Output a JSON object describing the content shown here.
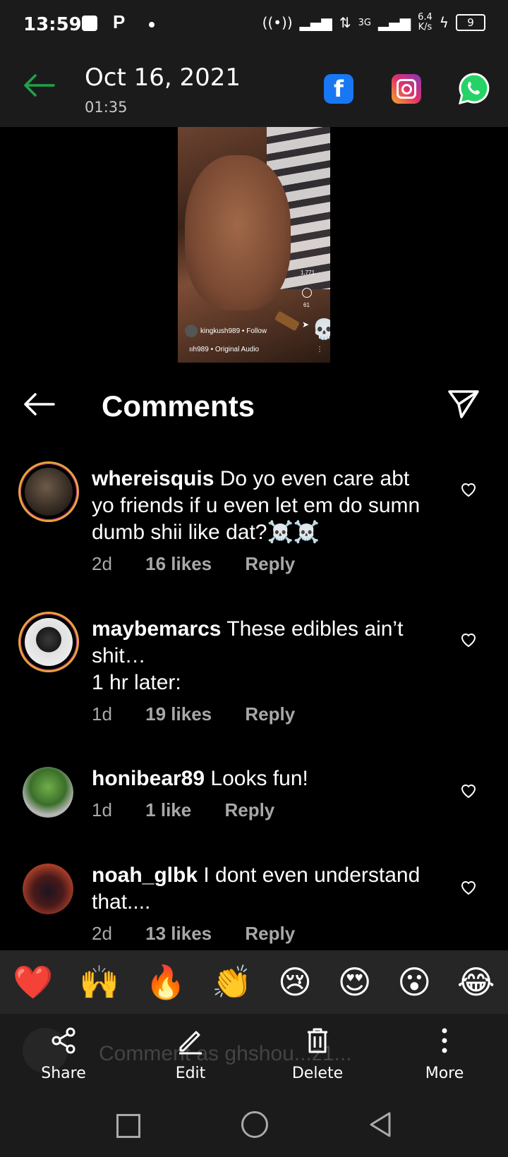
{
  "status_bar": {
    "time": "13:59",
    "network": "3G",
    "speed": "6.4\nK/s",
    "speed_top": "6.4",
    "speed_bottom": "K/s",
    "battery": "9"
  },
  "header": {
    "date": "Oct 16, 2021",
    "time": "01:35"
  },
  "share_targets": [
    "facebook",
    "instagram",
    "whatsapp"
  ],
  "video": {
    "likes": "1,771",
    "comments": "61",
    "user": "kingkush989 • Follow",
    "audio": "ııh989 • Original Audio"
  },
  "comments_panel": {
    "title": "Comments"
  },
  "comments": [
    {
      "user": "whereisquis",
      "text": "Do yo even care abt yo friends if u even let em do sumn dumb shii like dat?☠️☠️",
      "age": "2d",
      "likes": "16 likes",
      "reply": "Reply"
    },
    {
      "user": "maybemarcs",
      "text": "These edibles ain’t shit…",
      "text2": "1 hr later:",
      "age": "1d",
      "likes": "19 likes",
      "reply": "Reply"
    },
    {
      "user": "honibear89",
      "text": "Looks fun!",
      "age": "1d",
      "likes": "1 like",
      "reply": "Reply"
    },
    {
      "user": "noah_glbk",
      "text": "I dont even understand that....",
      "age": "2d",
      "likes": "13 likes",
      "reply": "Reply"
    }
  ],
  "emoji_bar": [
    "❤️",
    "🙌",
    "🔥",
    "👏",
    "😢",
    "😍",
    "😮",
    "😂"
  ],
  "comment_input": {
    "placeholder": "Comment as ghshou...z1..."
  },
  "actions": {
    "share": "Share",
    "edit": "Edit",
    "delete": "Delete",
    "more": "More"
  },
  "colors": {
    "accent_green": "#1ea34a",
    "ring": "#e8a33b",
    "bg": "#000000",
    "bar_bg": "#1b1b1b"
  }
}
